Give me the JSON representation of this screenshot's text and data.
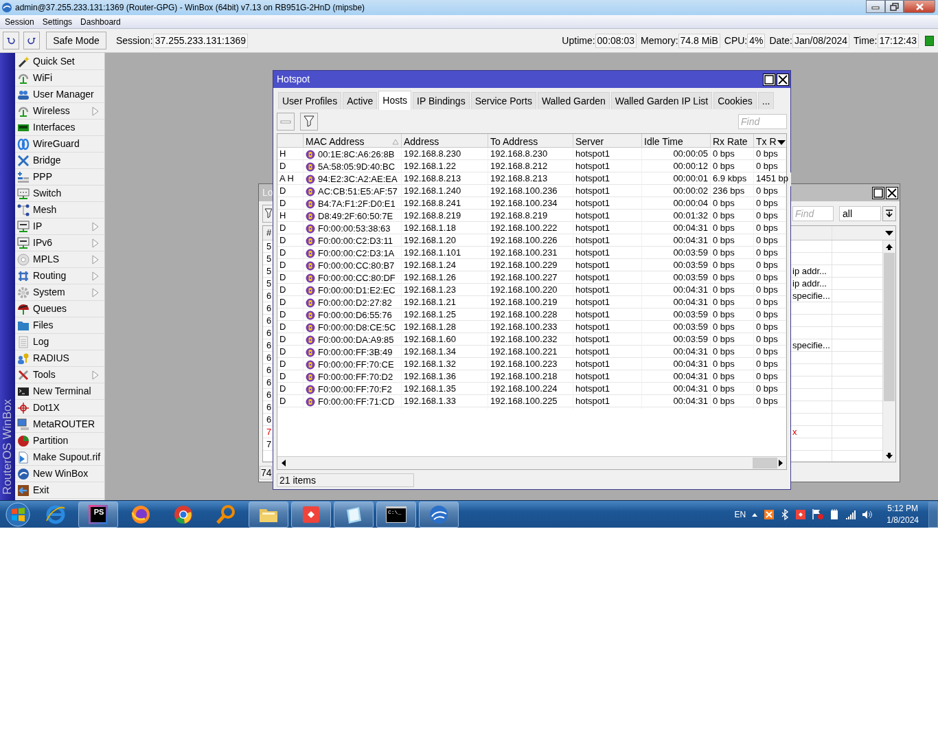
{
  "window": {
    "title": "admin@37.255.233.131:1369 (Router-GPG) - WinBox (64bit) v7.13 on RB951G-2HnD (mipsbe)"
  },
  "menu": [
    "Session",
    "Settings",
    "Dashboard"
  ],
  "toolbar": {
    "safe_mode": "Safe Mode",
    "session_label": "Session:",
    "session": "37.255.233.131:1369"
  },
  "status": [
    {
      "label": "Uptime:",
      "value": "00:08:03"
    },
    {
      "label": "Memory:",
      "value": "74.8 MiB"
    },
    {
      "label": "CPU:",
      "value": "4%"
    },
    {
      "label": "Date:",
      "value": "Jan/08/2024"
    },
    {
      "label": "Time:",
      "value": "17:12:43"
    }
  ],
  "sidebar": {
    "brand": "RouterOS WinBox",
    "items": [
      {
        "label": "Quick Set",
        "submenu": false
      },
      {
        "label": "WiFi",
        "submenu": false
      },
      {
        "label": "User Manager",
        "submenu": false
      },
      {
        "label": "Wireless",
        "submenu": true
      },
      {
        "label": "Interfaces",
        "submenu": false
      },
      {
        "label": "WireGuard",
        "submenu": false
      },
      {
        "label": "Bridge",
        "submenu": false
      },
      {
        "label": "PPP",
        "submenu": false
      },
      {
        "label": "Switch",
        "submenu": false
      },
      {
        "label": "Mesh",
        "submenu": false
      },
      {
        "label": "IP",
        "submenu": true
      },
      {
        "label": "IPv6",
        "submenu": true
      },
      {
        "label": "MPLS",
        "submenu": true
      },
      {
        "label": "Routing",
        "submenu": true
      },
      {
        "label": "System",
        "submenu": true
      },
      {
        "label": "Queues",
        "submenu": false
      },
      {
        "label": "Files",
        "submenu": false
      },
      {
        "label": "Log",
        "submenu": false
      },
      {
        "label": "RADIUS",
        "submenu": false
      },
      {
        "label": "Tools",
        "submenu": true
      },
      {
        "label": "New Terminal",
        "submenu": false
      },
      {
        "label": "Dot1X",
        "submenu": false
      },
      {
        "label": "MetaROUTER",
        "submenu": false
      },
      {
        "label": "Partition",
        "submenu": false
      },
      {
        "label": "Make Supout.rif",
        "submenu": false
      },
      {
        "label": "New WinBox",
        "submenu": false
      },
      {
        "label": "Exit",
        "submenu": false
      }
    ]
  },
  "log_window": {
    "title": "Lo",
    "column_1": "#",
    "find_placeholder": "Find",
    "filter": "all",
    "count": "74",
    "rows": [
      {
        "number": "5"
      },
      {
        "number": "5"
      },
      {
        "number": "5",
        "message": "ip addr..."
      },
      {
        "number": "5",
        "message": "ip addr..."
      },
      {
        "number": "6",
        "message": "specifie..."
      },
      {
        "number": "6"
      },
      {
        "number": "6"
      },
      {
        "number": "6"
      },
      {
        "number": "6",
        "message": "specifie..."
      },
      {
        "number": "6"
      },
      {
        "number": "6"
      },
      {
        "number": "6"
      },
      {
        "number": "6"
      },
      {
        "number": "6"
      },
      {
        "number": "6"
      },
      {
        "number": "7",
        "message": "x",
        "error": true
      },
      {
        "number": "7"
      }
    ]
  },
  "hotspot": {
    "title": "Hotspot",
    "tabs": [
      {
        "label": "User Profiles",
        "selected": false
      },
      {
        "label": "Active",
        "selected": false
      },
      {
        "label": "Hosts",
        "selected": true
      },
      {
        "label": "IP Bindings",
        "selected": false
      },
      {
        "label": "Service Ports",
        "selected": false
      },
      {
        "label": "Walled Garden",
        "selected": false
      },
      {
        "label": "Walled Garden IP List",
        "selected": false
      },
      {
        "label": "Cookies",
        "selected": false
      },
      {
        "label": "...",
        "selected": false
      }
    ],
    "find_placeholder": "Find",
    "columns": [
      "MAC Address",
      "Address",
      "To Address",
      "Server",
      "Idle Time",
      "Rx Rate",
      "Tx R"
    ],
    "rows": [
      {
        "flags": "H",
        "mac": "00:1E:8C:A6:26:8B",
        "address": "192.168.8.230",
        "to_address": "192.168.8.230",
        "server": "hotspot1",
        "idle_time": "00:00:05",
        "rx_rate": "0 bps",
        "tx_rate": "0 bps"
      },
      {
        "flags": "D",
        "mac": "5A:58:05:9D:40:BC",
        "address": "192.168.1.22",
        "to_address": "192.168.8.212",
        "server": "hotspot1",
        "idle_time": "00:00:12",
        "rx_rate": "0 bps",
        "tx_rate": "0 bps"
      },
      {
        "flags": "A H",
        "mac": "94:E2:3C:A2:AE:EA",
        "address": "192.168.8.213",
        "to_address": "192.168.8.213",
        "server": "hotspot1",
        "idle_time": "00:00:01",
        "rx_rate": "6.9 kbps",
        "tx_rate": "1451 bp"
      },
      {
        "flags": "D",
        "mac": "AC:CB:51:E5:AF:57",
        "address": "192.168.1.240",
        "to_address": "192.168.100.236",
        "server": "hotspot1",
        "idle_time": "00:00:02",
        "rx_rate": "236 bps",
        "tx_rate": "0 bps"
      },
      {
        "flags": "D",
        "mac": "B4:7A:F1:2F:D0:E1",
        "address": "192.168.8.241",
        "to_address": "192.168.100.234",
        "server": "hotspot1",
        "idle_time": "00:00:04",
        "rx_rate": "0 bps",
        "tx_rate": "0 bps"
      },
      {
        "flags": "H",
        "mac": "D8:49:2F:60:50:7E",
        "address": "192.168.8.219",
        "to_address": "192.168.8.219",
        "server": "hotspot1",
        "idle_time": "00:01:32",
        "rx_rate": "0 bps",
        "tx_rate": "0 bps"
      },
      {
        "flags": "D",
        "mac": "F0:00:00:53:38:63",
        "address": "192.168.1.18",
        "to_address": "192.168.100.222",
        "server": "hotspot1",
        "idle_time": "00:04:31",
        "rx_rate": "0 bps",
        "tx_rate": "0 bps"
      },
      {
        "flags": "D",
        "mac": "F0:00:00:C2:D3:11",
        "address": "192.168.1.20",
        "to_address": "192.168.100.226",
        "server": "hotspot1",
        "idle_time": "00:04:31",
        "rx_rate": "0 bps",
        "tx_rate": "0 bps"
      },
      {
        "flags": "D",
        "mac": "F0:00:00:C2:D3:1A",
        "address": "192.168.1.101",
        "to_address": "192.168.100.231",
        "server": "hotspot1",
        "idle_time": "00:03:59",
        "rx_rate": "0 bps",
        "tx_rate": "0 bps"
      },
      {
        "flags": "D",
        "mac": "F0:00:00:CC:80:B7",
        "address": "192.168.1.24",
        "to_address": "192.168.100.229",
        "server": "hotspot1",
        "idle_time": "00:03:59",
        "rx_rate": "0 bps",
        "tx_rate": "0 bps"
      },
      {
        "flags": "D",
        "mac": "F0:00:00:CC:80:DF",
        "address": "192.168.1.26",
        "to_address": "192.168.100.227",
        "server": "hotspot1",
        "idle_time": "00:03:59",
        "rx_rate": "0 bps",
        "tx_rate": "0 bps"
      },
      {
        "flags": "D",
        "mac": "F0:00:00:D1:E2:EC",
        "address": "192.168.1.23",
        "to_address": "192.168.100.220",
        "server": "hotspot1",
        "idle_time": "00:04:31",
        "rx_rate": "0 bps",
        "tx_rate": "0 bps"
      },
      {
        "flags": "D",
        "mac": "F0:00:00:D2:27:82",
        "address": "192.168.1.21",
        "to_address": "192.168.100.219",
        "server": "hotspot1",
        "idle_time": "00:04:31",
        "rx_rate": "0 bps",
        "tx_rate": "0 bps"
      },
      {
        "flags": "D",
        "mac": "F0:00:00:D6:55:76",
        "address": "192.168.1.25",
        "to_address": "192.168.100.228",
        "server": "hotspot1",
        "idle_time": "00:03:59",
        "rx_rate": "0 bps",
        "tx_rate": "0 bps"
      },
      {
        "flags": "D",
        "mac": "F0:00:00:D8:CE:5C",
        "address": "192.168.1.28",
        "to_address": "192.168.100.233",
        "server": "hotspot1",
        "idle_time": "00:03:59",
        "rx_rate": "0 bps",
        "tx_rate": "0 bps"
      },
      {
        "flags": "D",
        "mac": "F0:00:00:DA:A9:85",
        "address": "192.168.1.60",
        "to_address": "192.168.100.232",
        "server": "hotspot1",
        "idle_time": "00:03:59",
        "rx_rate": "0 bps",
        "tx_rate": "0 bps"
      },
      {
        "flags": "D",
        "mac": "F0:00:00:FF:3B:49",
        "address": "192.168.1.34",
        "to_address": "192.168.100.221",
        "server": "hotspot1",
        "idle_time": "00:04:31",
        "rx_rate": "0 bps",
        "tx_rate": "0 bps"
      },
      {
        "flags": "D",
        "mac": "F0:00:00:FF:70:CE",
        "address": "192.168.1.32",
        "to_address": "192.168.100.223",
        "server": "hotspot1",
        "idle_time": "00:04:31",
        "rx_rate": "0 bps",
        "tx_rate": "0 bps"
      },
      {
        "flags": "D",
        "mac": "F0:00:00:FF:70:D2",
        "address": "192.168.1.36",
        "to_address": "192.168.100.218",
        "server": "hotspot1",
        "idle_time": "00:04:31",
        "rx_rate": "0 bps",
        "tx_rate": "0 bps"
      },
      {
        "flags": "D",
        "mac": "F0:00:00:FF:70:F2",
        "address": "192.168.1.35",
        "to_address": "192.168.100.224",
        "server": "hotspot1",
        "idle_time": "00:04:31",
        "rx_rate": "0 bps",
        "tx_rate": "0 bps"
      },
      {
        "flags": "D",
        "mac": "F0:00:00:FF:71:CD",
        "address": "192.168.1.33",
        "to_address": "192.168.100.225",
        "server": "hotspot1",
        "idle_time": "00:04:31",
        "rx_rate": "0 bps",
        "tx_rate": "0 bps"
      }
    ],
    "status": "21 items"
  },
  "taskbar": {
    "editor_badge": "PS",
    "terminal_prompt": "C:\\_",
    "language": "EN",
    "time": "5:12 PM",
    "date": "1/8/2024"
  }
}
